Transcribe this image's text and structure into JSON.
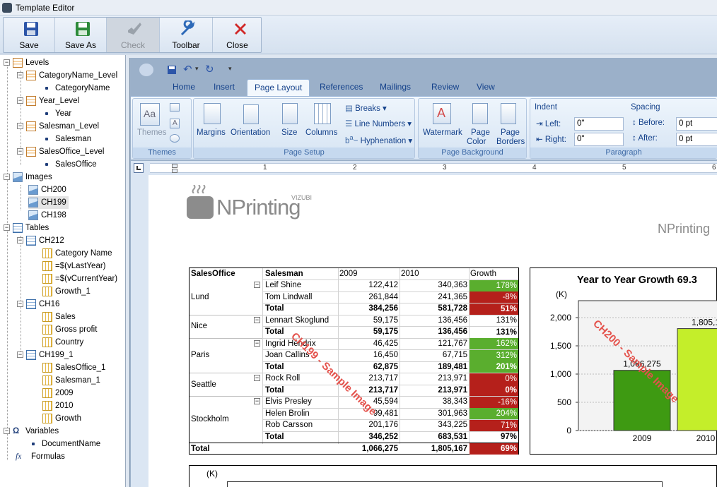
{
  "window": {
    "title": "Template Editor"
  },
  "toolbar": {
    "save": "Save",
    "save_as": "Save As",
    "check": "Check",
    "toolbar": "Toolbar",
    "close": "Close"
  },
  "tree": {
    "levels": "Levels",
    "category_level": "CategoryName_Level",
    "category_name": "CategoryName",
    "year_level": "Year_Level",
    "year": "Year",
    "salesman_level": "Salesman_Level",
    "salesman": "Salesman",
    "salesoffice_level": "SalesOffice_Level",
    "salesoffice": "SalesOffice",
    "images": "Images",
    "ch200": "CH200",
    "ch199": "CH199",
    "ch198": "CH198",
    "tables": "Tables",
    "ch212": "CH212",
    "ch212_cols": [
      "Category Name",
      "=$(vLastYear)",
      "=$(vCurrentYear)",
      "Growth_1"
    ],
    "ch16": "CH16",
    "ch16_cols": [
      "Sales",
      "Gross profit",
      "Country"
    ],
    "ch199_1": "CH199_1",
    "ch199_1_cols": [
      "SalesOffice_1",
      "Salesman_1",
      "2009",
      "2010",
      "Growth"
    ],
    "variables": "Variables",
    "document_name": "DocumentName",
    "formulas": "Formulas"
  },
  "ribbon": {
    "tabs": [
      "Home",
      "Insert",
      "Page Layout",
      "References",
      "Mailings",
      "Review",
      "View"
    ],
    "active_tab": "Page Layout",
    "themes": {
      "btn": "Themes",
      "group": "Themes"
    },
    "page_setup": {
      "margins": "Margins",
      "orientation": "Orientation",
      "size": "Size",
      "columns": "Columns",
      "breaks": "Breaks",
      "line_numbers": "Line Numbers",
      "hyphenation": "Hyphenation",
      "group": "Page Setup"
    },
    "page_background": {
      "watermark": "Watermark",
      "page_color_1": "Page",
      "page_color_2": "Color",
      "page_borders_1": "Page",
      "page_borders_2": "Borders",
      "group": "Page Background"
    },
    "paragraph": {
      "indent": "Indent",
      "left_label": "Left:",
      "left_value": "0\"",
      "right_label": "Right:",
      "right_value": "0\"",
      "spacing": "Spacing",
      "before_label": "Before:",
      "before_value": "0 pt",
      "after_label": "After:",
      "after_value": "0 pt",
      "group": "Paragraph"
    }
  },
  "ruler": {
    "marks": [
      "1",
      "2",
      "3",
      "4",
      "5",
      "6"
    ]
  },
  "document": {
    "logo_text": "NPrinting",
    "logo_sup": "VIZUBI",
    "header_right": "NPrinting",
    "table": {
      "headers": [
        "SalesOffice",
        "Salesman",
        "2009",
        "2010",
        "Growth"
      ],
      "rows": [
        {
          "office": "Lund",
          "name": "Leif Shine",
          "v2009": "122,412",
          "v2010": "340,363",
          "growth": "178%",
          "tone": "good",
          "bold": false
        },
        {
          "office": "",
          "name": "Tom Lindwall",
          "v2009": "261,844",
          "v2010": "241,365",
          "growth": "-8%",
          "tone": "bad",
          "bold": false
        },
        {
          "office": "",
          "name": "Total",
          "v2009": "384,256",
          "v2010": "581,728",
          "growth": "51%",
          "tone": "bad",
          "bold": true
        },
        {
          "office": "Nice",
          "name": "Lennart Skoglund",
          "v2009": "59,175",
          "v2010": "136,456",
          "growth": "131%",
          "tone": "none",
          "bold": false
        },
        {
          "office": "",
          "name": "Total",
          "v2009": "59,175",
          "v2010": "136,456",
          "growth": "131%",
          "tone": "none",
          "bold": true
        },
        {
          "office": "Paris",
          "name": "Ingrid Hendrix",
          "v2009": "46,425",
          "v2010": "121,767",
          "growth": "162%",
          "tone": "good",
          "bold": false
        },
        {
          "office": "",
          "name": "Joan Callins",
          "v2009": "16,450",
          "v2010": "67,715",
          "growth": "312%",
          "tone": "good",
          "bold": false
        },
        {
          "office": "",
          "name": "Total",
          "v2009": "62,875",
          "v2010": "189,481",
          "growth": "201%",
          "tone": "good",
          "bold": true
        },
        {
          "office": "Seattle",
          "name": "Rock Roll",
          "v2009": "213,717",
          "v2010": "213,971",
          "growth": "0%",
          "tone": "bad",
          "bold": false
        },
        {
          "office": "",
          "name": "Total",
          "v2009": "213,717",
          "v2010": "213,971",
          "growth": "0%",
          "tone": "bad",
          "bold": true
        },
        {
          "office": "Stockholm",
          "name": "Elvis Presley",
          "v2009": "45,594",
          "v2010": "38,343",
          "growth": "-16%",
          "tone": "bad",
          "bold": false
        },
        {
          "office": "",
          "name": "Helen Brolin",
          "v2009": "99,481",
          "v2010": "301,963",
          "growth": "204%",
          "tone": "good",
          "bold": false
        },
        {
          "office": "",
          "name": "Rob Carsson",
          "v2009": "201,176",
          "v2010": "343,225",
          "growth": "71%",
          "tone": "bad",
          "bold": false
        },
        {
          "office": "",
          "name": "Total",
          "v2009": "346,252",
          "v2010": "683,531",
          "growth": "97%",
          "tone": "none",
          "bold": true
        }
      ],
      "grand_total": {
        "label": "Total",
        "v2009": "1,066,275",
        "v2010": "1,805,167",
        "growth": "69%"
      }
    },
    "watermark_ch199": "CH199 - Sample Image",
    "watermark_ch200": "CH200 - Sample Image",
    "chart2_unit": "(K)"
  },
  "chart_data": {
    "type": "bar",
    "title": "Year to Year Growth 69.3",
    "ylabel": "(K)",
    "categories": [
      "2009",
      "2010"
    ],
    "values": [
      1066.275,
      1805.167
    ],
    "data_labels": [
      "1,066,275",
      "1,805,1"
    ],
    "yticks": [
      "0",
      "500",
      "1,000",
      "1,500",
      "2,000"
    ],
    "ylim": [
      0,
      2300
    ],
    "colors": {
      "bar2009": "#3e9a12",
      "bar2010": "#c4ee2a"
    }
  }
}
